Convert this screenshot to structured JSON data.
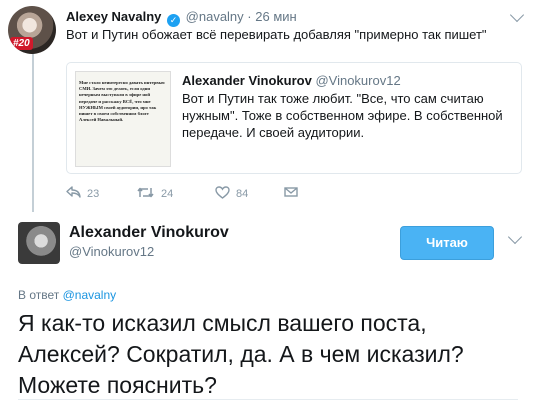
{
  "tweet1": {
    "name": "Alexey Navalny",
    "verified_glyph": "✓",
    "handle": "@navalny",
    "separator": "·",
    "time": "26 мин",
    "text": "Вот и Путин обожает всё перевирать добавляя \"примерно так пишет\"",
    "avatar_badge": "#20",
    "quote": {
      "name": "Alexander Vinokurov",
      "handle": "@Vinokurov12",
      "text": "Вот и Путин так тоже любит. \"Все, что сам считаю нужным\". Тоже в собственном эфире. В собственной передаче. И своей аудитории.",
      "image_text": "Мне стало неинтересно давать интервью СМИ. Зачем это делать, если одни нечерным выступали в эфире ной передаче и расскажу ВСЁ, что мне НУЖНЫМ своей аудитории, иро так пишет в своем собственном блоге Алексей Навальный."
    },
    "actions": {
      "reply_count": "23",
      "retweet_count": "24",
      "like_count": "84"
    }
  },
  "tweet2": {
    "name": "Alexander Vinokurov",
    "handle": "@Vinokurov12",
    "follow_label": "Читаю",
    "reply_prefix": "В ответ ",
    "reply_handle": "@navalny",
    "text": "Я как-то исказил смысл вашего поста, Алексей? Сократил, да. А в чем исказил? Можете пояснить?"
  },
  "icons": {
    "reply": "reply-icon",
    "retweet": "retweet-icon",
    "like": "heart-icon",
    "dm": "envelope-icon",
    "more": "chevron-down-icon"
  },
  "colors": {
    "accent": "#1da1f2",
    "follow_button": "#4ab3f4",
    "link": "#1b95e0",
    "muted": "#657786",
    "badge": "#d0192b"
  }
}
